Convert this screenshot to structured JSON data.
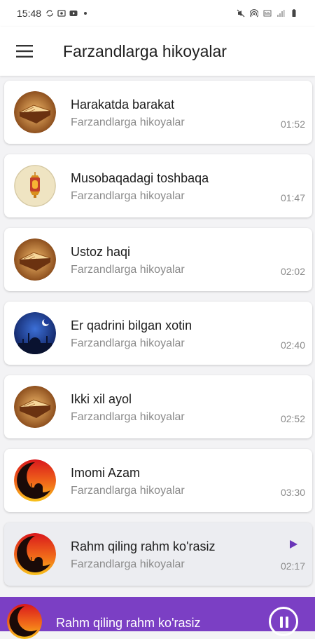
{
  "status_bar": {
    "time": "15:48"
  },
  "app_bar": {
    "title": "Farzandlarga hikoyalar"
  },
  "tracks": [
    {
      "title": "Harakatda barakat",
      "subtitle": "Farzandlarga hikoyalar",
      "duration": "01:52",
      "icon": "book-icon"
    },
    {
      "title": "Musobaqadagi toshbaqa",
      "subtitle": "Farzandlarga hikoyalar",
      "duration": "01:47",
      "icon": "lantern-icon"
    },
    {
      "title": "Ustoz haqi",
      "subtitle": "Farzandlarga hikoyalar",
      "duration": "02:02",
      "icon": "book-icon"
    },
    {
      "title": "Er qadrini bilgan xotin",
      "subtitle": "Farzandlarga hikoyalar",
      "duration": "02:40",
      "icon": "mosque-night-icon"
    },
    {
      "title": "Ikki xil ayol",
      "subtitle": "Farzandlarga hikoyalar",
      "duration": "02:52",
      "icon": "book-icon"
    },
    {
      "title": "Imomi Azam",
      "subtitle": "Farzandlarga hikoyalar",
      "duration": "03:30",
      "icon": "mosque-sunset-icon"
    },
    {
      "title": "Rahm qiling rahm ko'rasiz",
      "subtitle": "Farzandlarga hikoyalar",
      "duration": "02:17",
      "icon": "mosque-sunset-icon",
      "playing": true
    }
  ],
  "player": {
    "title": "Rahm qiling rahm ko'rasiz",
    "icon": "mosque-sunset-icon"
  },
  "colors": {
    "accent": "#7b3fc4",
    "play_arrow": "#6a35b8"
  }
}
